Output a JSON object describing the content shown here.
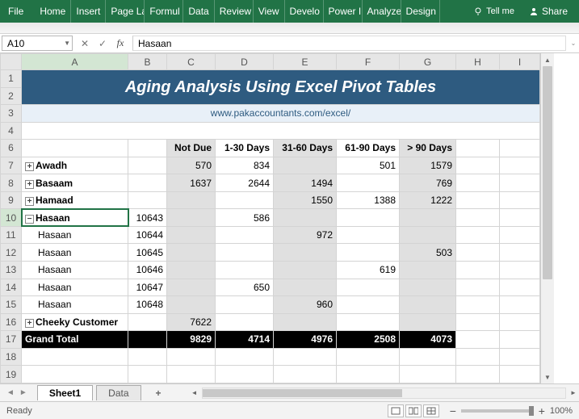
{
  "ribbon": {
    "file": "File",
    "tabs": [
      "Home",
      "Insert",
      "Page La",
      "Formul",
      "Data",
      "Review",
      "View",
      "Develo",
      "Power I",
      "Analyze",
      "Design"
    ],
    "tell_me": "Tell me",
    "share": "Share"
  },
  "formula": {
    "namebox": "A10",
    "value": "Hasaan"
  },
  "columns": [
    "A",
    "B",
    "C",
    "D",
    "E",
    "F",
    "G",
    "H",
    "I"
  ],
  "title": "Aging Analysis Using Excel Pivot Tables",
  "url": "www.pakaccountants.com/excel/",
  "headers": [
    "Not Due",
    "1-30 Days",
    "31-60 Days",
    "61-90 Days",
    "> 90 Days"
  ],
  "rows": [
    {
      "n": "7",
      "name": "Awadh",
      "toggle": "+",
      "vals": [
        "",
        "570",
        "834",
        "",
        "501",
        "1579"
      ]
    },
    {
      "n": "8",
      "name": "Basaam",
      "toggle": "+",
      "vals": [
        "",
        "1637",
        "2644",
        "1494",
        "",
        "769"
      ]
    },
    {
      "n": "9",
      "name": "Hamaad",
      "toggle": "+",
      "vals": [
        "",
        "",
        "",
        "1550",
        "1388",
        "1222"
      ]
    },
    {
      "n": "10",
      "name": "Hasaan",
      "toggle": "−",
      "vals": [
        "10643",
        "",
        "586",
        "",
        "",
        ""
      ],
      "active": true
    },
    {
      "n": "11",
      "name": "Hasaan",
      "indent": true,
      "vals": [
        "10644",
        "",
        "",
        "972",
        "",
        ""
      ]
    },
    {
      "n": "12",
      "name": "Hasaan",
      "indent": true,
      "vals": [
        "10645",
        "",
        "",
        "",
        "",
        "503"
      ]
    },
    {
      "n": "13",
      "name": "Hasaan",
      "indent": true,
      "vals": [
        "10646",
        "",
        "",
        "",
        "619",
        ""
      ]
    },
    {
      "n": "14",
      "name": "Hasaan",
      "indent": true,
      "vals": [
        "10647",
        "",
        "650",
        "",
        "",
        ""
      ]
    },
    {
      "n": "15",
      "name": "Hasaan",
      "indent": true,
      "vals": [
        "10648",
        "",
        "",
        "960",
        "",
        ""
      ]
    },
    {
      "n": "16",
      "name": "Cheeky Customer",
      "toggle": "+",
      "vals": [
        "",
        "7622",
        "",
        "",
        "",
        ""
      ]
    }
  ],
  "grand_total": {
    "label": "Grand Total",
    "vals": [
      "",
      "9829",
      "4714",
      "4976",
      "2508",
      "4073"
    ]
  },
  "sheet_tabs": {
    "active": "Sheet1",
    "others": [
      "Data"
    ],
    "add": "+"
  },
  "status": {
    "ready": "Ready",
    "zoom": "100%"
  }
}
